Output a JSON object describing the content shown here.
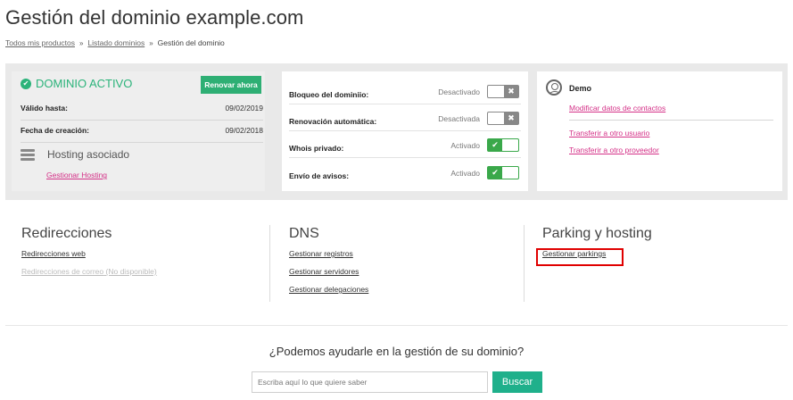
{
  "page": {
    "title": "Gestión del dominio example.com"
  },
  "breadcrumb": {
    "items": [
      "Todos mis productos",
      "Listado dominios",
      "Gestión del dominio"
    ],
    "separator": "»"
  },
  "status": {
    "label": "DOMINIO ACTIVO",
    "renew_label": "Renovar ahora",
    "valid_until_label": "Válido hasta:",
    "valid_until_value": "09/02/2019",
    "created_label": "Fecha de creación:",
    "created_value": "09/02/2018",
    "hosting_label": "Hosting asociado",
    "manage_hosting_link": "Gestionar Hosting",
    "status_color": "#2bb37a"
  },
  "options": [
    {
      "label": "Bloqueo del dominiio:",
      "state": "Desactivado",
      "on": false
    },
    {
      "label": "Renovación automática:",
      "state": "Desactivada",
      "on": false
    },
    {
      "label": "Whois privado:",
      "state": "Activado",
      "on": true
    },
    {
      "label": "Envío de avisos:",
      "state": "Activado",
      "on": true
    }
  ],
  "user": {
    "name": "Demo",
    "modify_contacts_link": "Modificar datos de contactos",
    "transfer_user_link": "Transferir a otro usuario",
    "transfer_provider_link": "Transferir a otro proveedor",
    "link_color": "#d43087"
  },
  "sections": {
    "redirects": {
      "title": "Redirecciones",
      "web_link": "Redirecciones web",
      "mail_link": "Redirecciones de correo",
      "mail_note": "(No disponible)"
    },
    "dns": {
      "title": "DNS",
      "records_link": "Gestionar registros",
      "servers_link": "Gestionar servidores",
      "delegations_link": "Gestionar delegaciones"
    },
    "parking": {
      "title": "Parking y hosting",
      "parkings_link": "Gestionar parkings"
    }
  },
  "help": {
    "title": "¿Podemos ayudarle en la gestión de su dominio?",
    "search_placeholder": "Escriba aquí lo que quiere saber",
    "search_button": "Buscar"
  }
}
